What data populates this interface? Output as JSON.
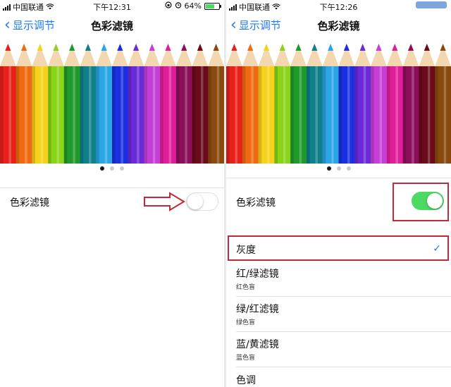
{
  "colors": {
    "accent": "#1f7bf5",
    "switch_on": "#4cd964",
    "annotation_red": "#c22a3a"
  },
  "left": {
    "status": {
      "carrier": "中国联通",
      "time": "下午12:31",
      "battery": "64%",
      "battery_fraction": 0.64
    },
    "nav": {
      "back_label": "显示调节",
      "title": "色彩滤镜"
    },
    "page_dots": {
      "count": 3,
      "active": 0
    },
    "filter_row": {
      "label": "色彩滤镜",
      "switch_on": false
    },
    "annotation": "arrow-pointing-to-switch"
  },
  "right": {
    "status": {
      "carrier": "中国联通",
      "time": "下午12:26"
    },
    "nav": {
      "back_label": "显示调节",
      "title": "色彩滤镜"
    },
    "page_dots": {
      "count": 3,
      "active": 0
    },
    "filter_row": {
      "label": "色彩滤镜",
      "switch_on": true
    },
    "options": [
      {
        "label": "灰度",
        "sublabel": "",
        "selected": true
      },
      {
        "label": "红/绿滤镜",
        "sublabel": "红色盲",
        "selected": false
      },
      {
        "label": "绿/红滤镜",
        "sublabel": "绿色盲",
        "selected": false
      },
      {
        "label": "蓝/黄滤镜",
        "sublabel": "蓝色盲",
        "selected": false
      },
      {
        "label": "色调",
        "sublabel": "",
        "selected": false
      }
    ],
    "check_icon": "✓"
  },
  "pencil_colors": [
    "#e8201a",
    "#f06a12",
    "#f7d21a",
    "#8ad41a",
    "#1f9a2a",
    "#0f7f8a",
    "#2aa6e6",
    "#1a2fe0",
    "#6a2ad8",
    "#c63ed8",
    "#e11e9a",
    "#8c0f5a",
    "#6a0a1a",
    "#8a4a0f"
  ]
}
